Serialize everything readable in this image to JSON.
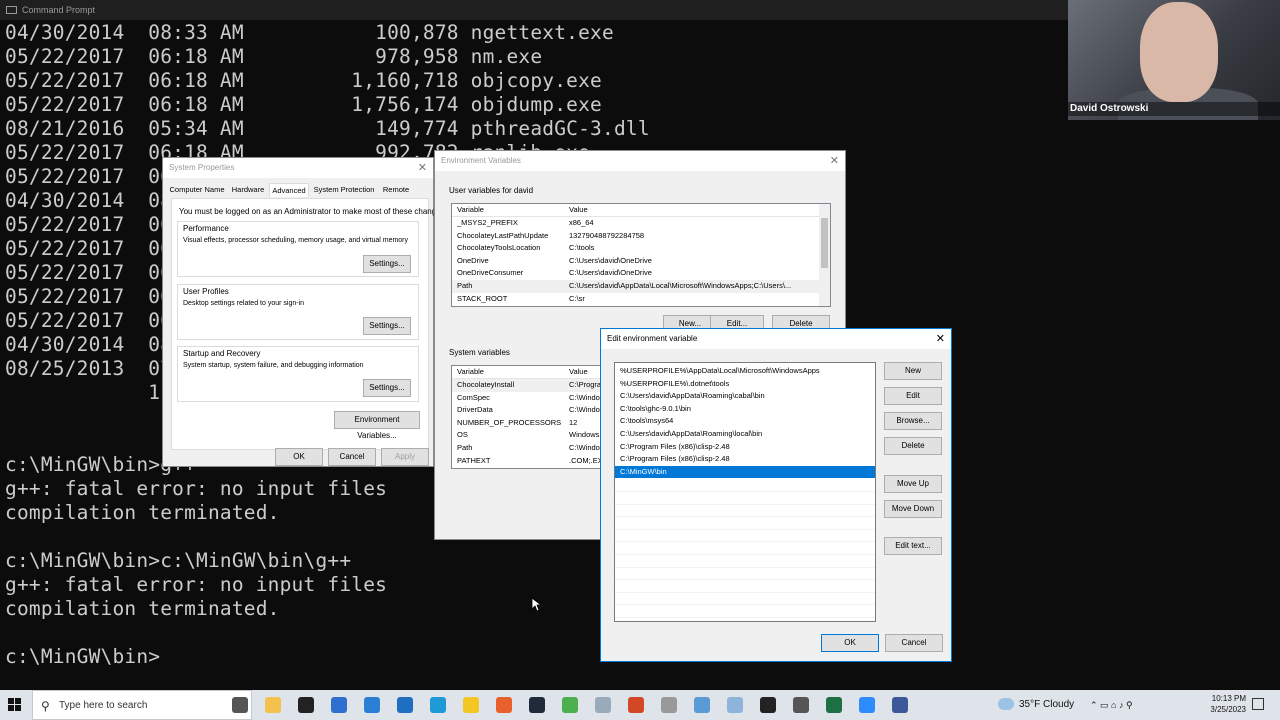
{
  "cmd": {
    "title": "Command Prompt",
    "lines": [
      "04/30/2014  08:33 AM           100,878 ngettext.exe",
      "05/22/2017  06:18 AM           978,958 nm.exe",
      "05/22/2017  06:18 AM         1,160,718 objcopy.exe",
      "05/22/2017  06:18 AM         1,756,174 objdump.exe",
      "08/21/2016  05:34 AM           149,774 pthreadGC-3.dll",
      "05/22/2017  06:18 AM           992,782 ranlib.exe",
      "05/22/2017  06",
      "04/30/2014  08",
      "05/22/2017  06",
      "05/22/2017  06",
      "05/22/2017  06",
      "05/22/2017  06",
      "05/22/2017  06",
      "04/30/2014  08",
      "08/25/2013  07",
      "            1"
    ],
    "lines_bottom": [
      "c:\\MinGW\\bin>g++",
      "g++: fatal error: no input files",
      "compilation terminated.",
      "",
      "c:\\MinGW\\bin>c:\\MinGW\\bin\\g++",
      "g++: fatal error: no input files",
      "compilation terminated.",
      "",
      "c:\\MinGW\\bin>"
    ]
  },
  "webcam": {
    "name": "David Ostrowski"
  },
  "system_properties": {
    "title": "System Properties",
    "tabs": [
      "Computer Name",
      "Hardware",
      "Advanced",
      "System Protection",
      "Remote"
    ],
    "admin_note": "You must be logged on as an Administrator to make most of these changes.",
    "performance": {
      "title": "Performance",
      "desc": "Visual effects, processor scheduling, memory usage, and virtual memory",
      "button": "Settings..."
    },
    "user_profiles": {
      "title": "User Profiles",
      "desc": "Desktop settings related to your sign-in",
      "button": "Settings..."
    },
    "startup": {
      "title": "Startup and Recovery",
      "desc": "System startup, system failure, and debugging information",
      "button": "Settings..."
    },
    "env_button": "Environment Variables...",
    "ok": "OK",
    "cancel": "Cancel",
    "apply": "Apply"
  },
  "env_vars": {
    "title": "Environment Variables",
    "user_label": "User variables for david",
    "col_variable": "Variable",
    "col_value": "Value",
    "user_rows": [
      {
        "var": "_MSYS2_PREFIX",
        "val": "x86_64"
      },
      {
        "var": "ChocolateyLastPathUpdate",
        "val": "132790488792284758"
      },
      {
        "var": "ChocolateyToolsLocation",
        "val": "C:\\tools"
      },
      {
        "var": "OneDrive",
        "val": "C:\\Users\\david\\OneDrive"
      },
      {
        "var": "OneDriveConsumer",
        "val": "C:\\Users\\david\\OneDrive"
      },
      {
        "var": "Path",
        "val": "C:\\Users\\david\\AppData\\Local\\Microsoft\\WindowsApps;C:\\Users\\..."
      },
      {
        "var": "STACK_ROOT",
        "val": "C:\\sr"
      }
    ],
    "new": "New...",
    "edit": "Edit...",
    "delete": "Delete",
    "system_label": "System variables",
    "system_rows": [
      {
        "var": "ChocolateyInstall",
        "val": "C:\\Progra"
      },
      {
        "var": "ComSpec",
        "val": "C:\\Windo"
      },
      {
        "var": "DriverData",
        "val": "C:\\Windo"
      },
      {
        "var": "NUMBER_OF_PROCESSORS",
        "val": "12"
      },
      {
        "var": "OS",
        "val": "Windows"
      },
      {
        "var": "Path",
        "val": "C:\\Windo"
      },
      {
        "var": "PATHEXT",
        "val": ".COM;.EX"
      }
    ]
  },
  "edit_env": {
    "title": "Edit environment variable",
    "entries": [
      "%USERPROFILE%\\AppData\\Local\\Microsoft\\WindowsApps",
      "%USERPROFILE%\\.dotnet\\tools",
      "C:\\Users\\david\\AppData\\Roaming\\cabal\\bin",
      "C:\\tools\\ghc-9.0.1\\bin",
      "C:\\tools\\msys64",
      "C:\\Users\\david\\AppData\\Roaming\\local\\bin",
      "C:\\Program Files (x86)\\clisp-2.48",
      "C:\\Program Files (x86)\\clisp-2.48",
      "C:\\MinGW\\bin"
    ],
    "selected_index": 8,
    "buttons": [
      "New",
      "Edit",
      "Browse...",
      "Delete",
      "Move Up",
      "Move Down",
      "Edit text..."
    ],
    "ok": "OK",
    "cancel": "Cancel",
    "accent": "#0078d7"
  },
  "taskbar": {
    "search_placeholder": "Type here to search",
    "weather": "35°F  Cloudy",
    "time": "10:13 PM",
    "date": "3/25/2023"
  }
}
